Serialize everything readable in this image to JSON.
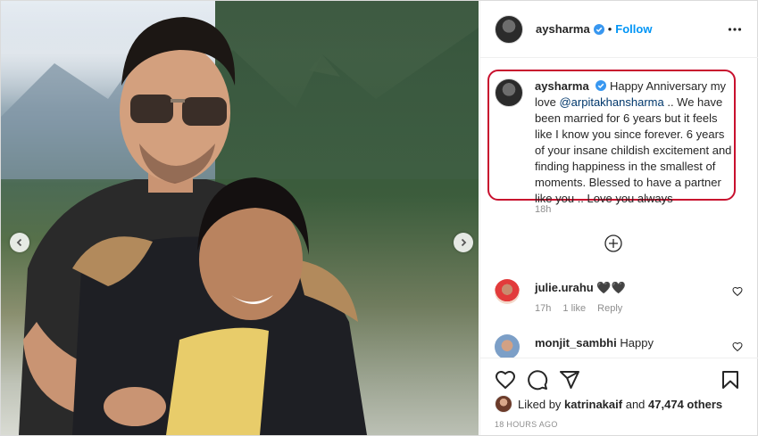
{
  "header": {
    "username": "aysharma",
    "separator": "•",
    "follow_label": "Follow"
  },
  "caption": {
    "username": "aysharma",
    "text_before": "Happy Anniversary my love ",
    "mention": "@arpitakhansharma",
    "text_after": " .. We have been married for 6 years but it feels like I know you since forever. 6 years of your insane childish excitement and finding happiness in the smallest of moments. Blessed to have a partner like you .. Love you always",
    "time": "18h"
  },
  "comments": [
    {
      "username": "julie.urahu",
      "text": "🖤🖤",
      "time": "17h",
      "likes": "1 like",
      "reply_label": "Reply"
    },
    {
      "username": "monjit_sambhi",
      "text": "Happy"
    }
  ],
  "likes": {
    "prefix": "Liked by",
    "user": "katrinakaif",
    "connector": "and",
    "count": "47,474 others"
  },
  "timestamp": "18 HOURS AGO",
  "icons": {
    "verified": "verified-badge-icon",
    "more": "more-options-icon",
    "load_more": "plus-circle-icon",
    "like": "heart-icon",
    "comment": "comment-icon",
    "share": "paper-plane-icon",
    "save": "bookmark-icon",
    "prev": "chevron-left-icon",
    "next": "chevron-right-icon"
  },
  "colors": {
    "accent": "#0095f6",
    "highlight_border": "#c8102e",
    "muted": "#8e8e8e",
    "text": "#262626"
  }
}
